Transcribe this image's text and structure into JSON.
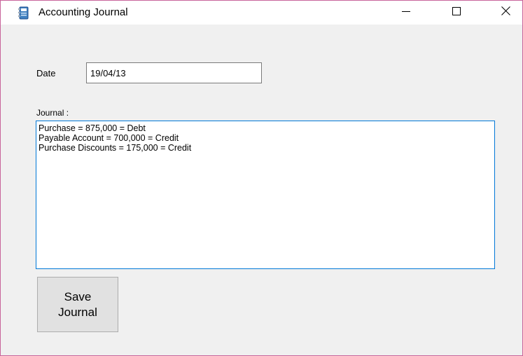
{
  "window": {
    "title": "Accounting Journal",
    "icon": "journal-book-icon",
    "controls": {
      "minimize": "minimize-icon",
      "maximize": "maximize-icon",
      "close": "close-icon"
    }
  },
  "form": {
    "date_label": "Date",
    "date_value": "19/04/13",
    "journal_label": "Journal :",
    "journal_lines": [
      "Purchase = 875,000 = Debt",
      "Payable Account = 700,000 = Credit",
      "Purchase Discounts = 175,000 = Credit"
    ],
    "save_button": {
      "line1": "Save",
      "line2": "Journal"
    }
  },
  "colors": {
    "window_border": "#c8649b",
    "focus_border": "#0078d7",
    "button_face": "#e1e1e1",
    "form_background": "#f0f0f0"
  }
}
